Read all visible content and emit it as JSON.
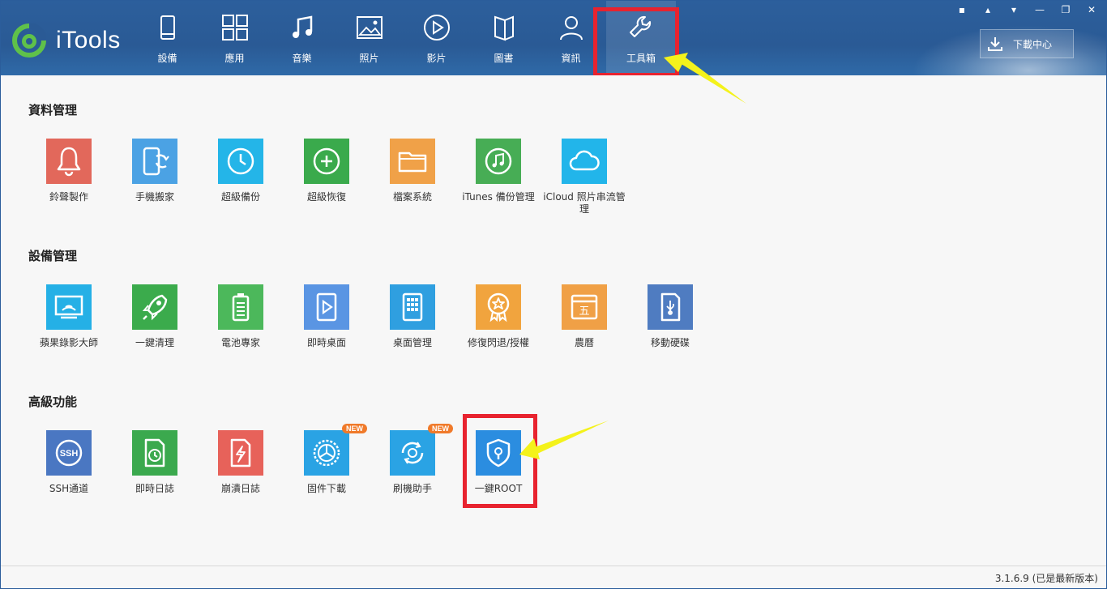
{
  "app": {
    "name": "iTools"
  },
  "nav": [
    {
      "label": "設備",
      "icon": "phone-icon"
    },
    {
      "label": "應用",
      "icon": "apps-grid-icon"
    },
    {
      "label": "音樂",
      "icon": "music-note-icon"
    },
    {
      "label": "照片",
      "icon": "photo-icon"
    },
    {
      "label": "影片",
      "icon": "play-icon"
    },
    {
      "label": "圖書",
      "icon": "book-icon"
    },
    {
      "label": "資訊",
      "icon": "person-icon"
    },
    {
      "label": "工具箱",
      "icon": "wrench-icon",
      "active": true
    }
  ],
  "download_center": {
    "label": "下載中心"
  },
  "sections": {
    "data_mgmt": {
      "title": "資料管理",
      "tools": [
        {
          "name": "鈴聲製作",
          "color": "#e2685b",
          "icon": "bell-icon"
        },
        {
          "name": "手機搬家",
          "color": "#4ba2e4",
          "icon": "phone-transfer-icon"
        },
        {
          "name": "超級備份",
          "color": "#24b5e8",
          "icon": "clock-backup-icon"
        },
        {
          "name": "超級恢復",
          "color": "#3aaa4c",
          "icon": "restore-plus-icon"
        },
        {
          "name": "檔案系統",
          "color": "#f0a148",
          "icon": "folder-icon"
        },
        {
          "name": "iTunes 備份管理",
          "color": "#47ad55",
          "icon": "itunes-backup-icon"
        },
        {
          "name": "iCloud 照片串流管理",
          "color": "#22b5ea",
          "icon": "cloud-icon"
        }
      ]
    },
    "device_mgmt": {
      "title": "設備管理",
      "tools": [
        {
          "name": "蘋果錄影大師",
          "color": "#25b0e6",
          "icon": "screen-mirror-icon"
        },
        {
          "name": "一鍵清理",
          "color": "#3bab4c",
          "icon": "rocket-icon"
        },
        {
          "name": "電池專家",
          "color": "#4cb85b",
          "icon": "battery-icon"
        },
        {
          "name": "即時桌面",
          "color": "#5a95e3",
          "icon": "live-desktop-icon"
        },
        {
          "name": "桌面管理",
          "color": "#2f9fe0",
          "icon": "desktop-grid-icon"
        },
        {
          "name": "修復閃退/授權",
          "color": "#f1a43e",
          "icon": "medal-star-icon"
        },
        {
          "name": "農曆",
          "color": "#f0a046",
          "icon": "calendar-icon"
        },
        {
          "name": "移動硬碟",
          "color": "#4f7cc1",
          "icon": "usb-disk-icon"
        }
      ]
    },
    "advanced": {
      "title": "高級功能",
      "tools": [
        {
          "name": "SSH通道",
          "color": "#4a77c2",
          "icon": "ssh-icon"
        },
        {
          "name": "即時日誌",
          "color": "#3ba94e",
          "icon": "log-clock-icon"
        },
        {
          "name": "崩潰日誌",
          "color": "#e7625a",
          "icon": "crash-log-icon"
        },
        {
          "name": "固件下載",
          "color": "#2aa3e4",
          "icon": "firmware-gear-icon",
          "badge": "NEW"
        },
        {
          "name": "刷機助手",
          "color": "#2aa3e4",
          "icon": "flash-assistant-icon",
          "badge": "NEW"
        },
        {
          "name": "一鍵ROOT",
          "color": "#2b8de0",
          "icon": "shield-key-icon"
        }
      ]
    }
  },
  "status": {
    "version": "3.1.6.9 (已是最新版本)"
  }
}
